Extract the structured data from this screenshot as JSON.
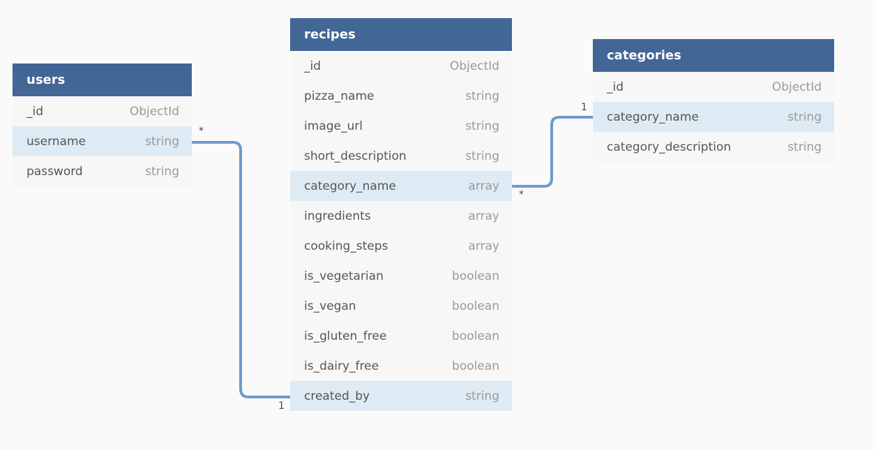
{
  "tables": {
    "users": {
      "title": "users",
      "fields": [
        {
          "name": "_id",
          "type": "ObjectId"
        },
        {
          "name": "username",
          "type": "string"
        },
        {
          "name": "password",
          "type": "string"
        }
      ]
    },
    "recipes": {
      "title": "recipes",
      "fields": [
        {
          "name": "_id",
          "type": "ObjectId"
        },
        {
          "name": "pizza_name",
          "type": "string"
        },
        {
          "name": "image_url",
          "type": "string"
        },
        {
          "name": "short_description",
          "type": "string"
        },
        {
          "name": "category_name",
          "type": "array"
        },
        {
          "name": "ingredients",
          "type": "array"
        },
        {
          "name": "cooking_steps",
          "type": "array"
        },
        {
          "name": "is_vegetarian",
          "type": "boolean"
        },
        {
          "name": "is_vegan",
          "type": "boolean"
        },
        {
          "name": "is_gluten_free",
          "type": "boolean"
        },
        {
          "name": "is_dairy_free",
          "type": "boolean"
        },
        {
          "name": "created_by",
          "type": "string"
        }
      ]
    },
    "categories": {
      "title": "categories",
      "fields": [
        {
          "name": "_id",
          "type": "ObjectId"
        },
        {
          "name": "category_name",
          "type": "string"
        },
        {
          "name": "category_description",
          "type": "string"
        }
      ]
    }
  },
  "relationships": [
    {
      "from": "users.username",
      "to": "recipes.created_by",
      "from_cardinality": "*",
      "to_cardinality": "1"
    },
    {
      "from": "recipes.category_name",
      "to": "categories.category_name",
      "from_cardinality": "*",
      "to_cardinality": "1"
    }
  ],
  "colors": {
    "header_bg": "#426696",
    "header_text": "#ffffff",
    "row_bg": "#f7f7f7",
    "highlight_bg": "#deebf4",
    "connector": "#6f9bcc"
  }
}
